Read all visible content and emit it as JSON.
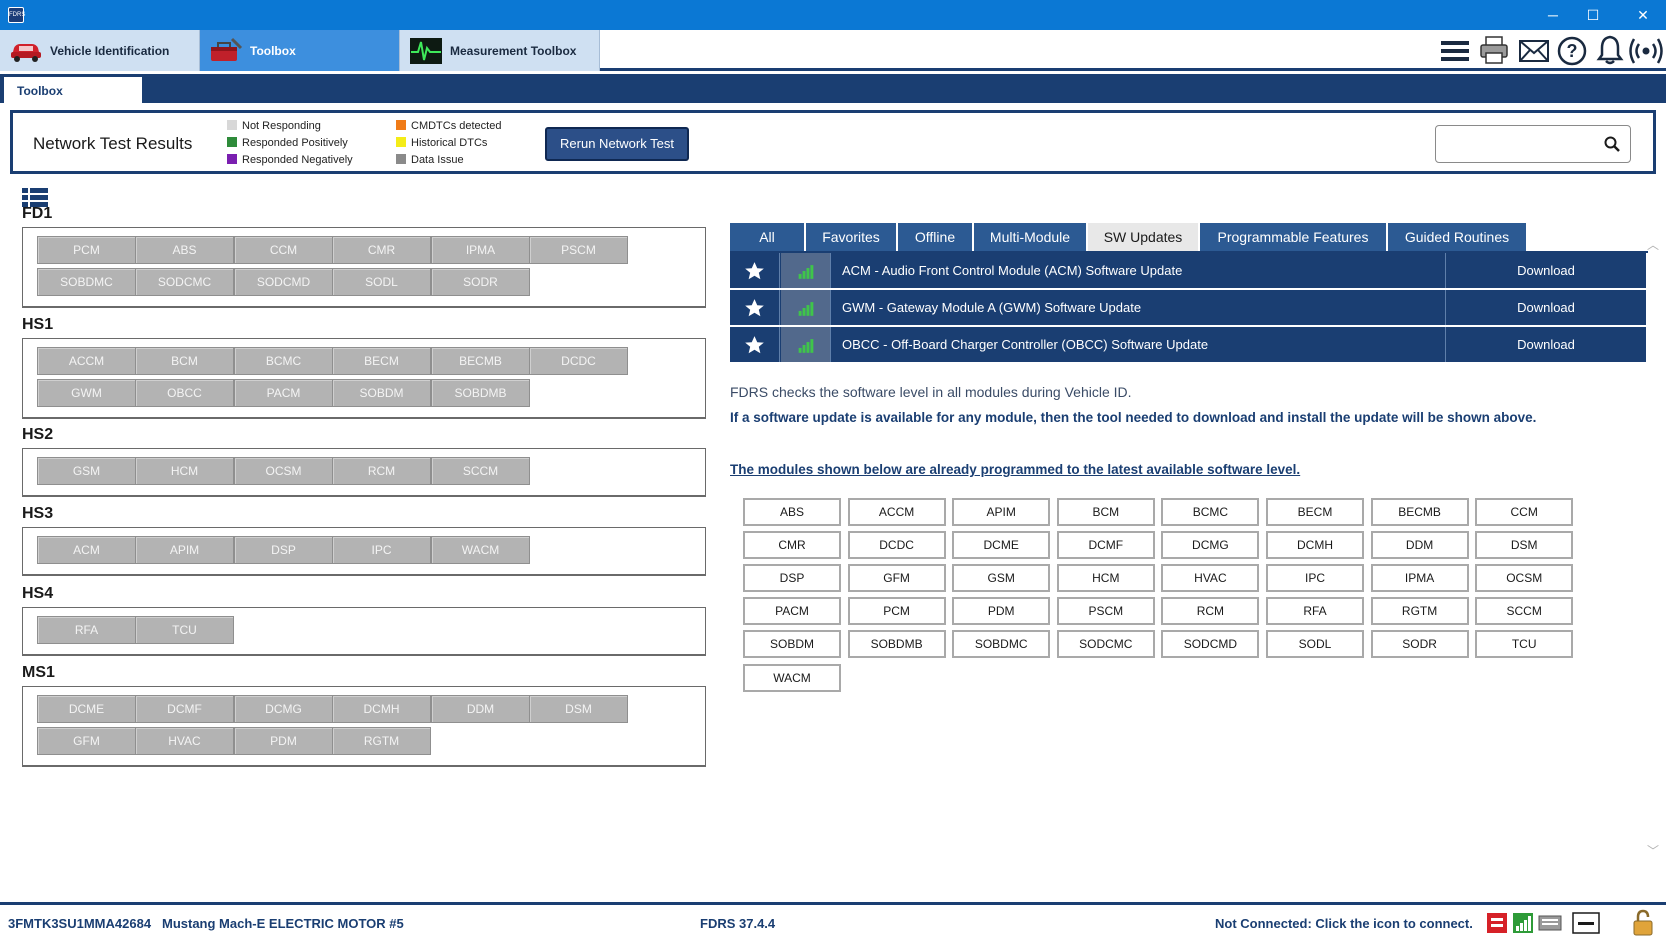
{
  "titlebar": {
    "minimize": "─",
    "maximize": "☐",
    "close": "✕"
  },
  "nav": {
    "tabs": [
      {
        "label": "Vehicle Identification",
        "icon": "car-icon"
      },
      {
        "label": "Toolbox",
        "icon": "toolbox-icon"
      },
      {
        "label": "Measurement Toolbox",
        "icon": "oscilloscope-icon"
      }
    ],
    "toolbar_icons": [
      "menu-icon",
      "printer-icon",
      "mail-icon",
      "help-icon",
      "bell-icon",
      "wireless-icon"
    ]
  },
  "subtab": {
    "label": "Toolbox"
  },
  "network": {
    "title": "Network Test Results",
    "legend": [
      {
        "label": "Not Responding",
        "color": "#d8d8d8"
      },
      {
        "label": "Responded Positively",
        "color": "#2e8b3a"
      },
      {
        "label": "Responded Negatively",
        "color": "#7a1fb0"
      },
      {
        "label": "CMDTCs detected",
        "color": "#f07b17"
      },
      {
        "label": "Historical DTCs",
        "color": "#f4ec18"
      },
      {
        "label": "Data Issue",
        "color": "#8a8a8a"
      }
    ],
    "rerun_label": "Rerun Network Test",
    "search_placeholder": ""
  },
  "groups": [
    {
      "name": "FD1",
      "modules": [
        "PCM",
        "ABS",
        "CCM",
        "CMR",
        "IPMA",
        "PSCM",
        "SOBDMC",
        "SODCMC",
        "SODCMD",
        "SODL",
        "SODR"
      ]
    },
    {
      "name": "HS1",
      "modules": [
        "ACCM",
        "BCM",
        "BCMC",
        "BECM",
        "BECMB",
        "DCDC",
        "GWM",
        "OBCC",
        "PACM",
        "SOBDM",
        "SOBDMB"
      ]
    },
    {
      "name": "HS2",
      "modules": [
        "GSM",
        "HCM",
        "OCSM",
        "RCM",
        "SCCM"
      ]
    },
    {
      "name": "HS3",
      "modules": [
        "ACM",
        "APIM",
        "DSP",
        "IPC",
        "WACM"
      ]
    },
    {
      "name": "HS4",
      "modules": [
        "RFA",
        "TCU"
      ]
    },
    {
      "name": "MS1",
      "modules": [
        "DCME",
        "DCMF",
        "DCMG",
        "DCMH",
        "DDM",
        "DSM",
        "GFM",
        "HVAC",
        "PDM",
        "RGTM"
      ]
    }
  ],
  "filter_tabs": [
    "All",
    "Favorites",
    "Offline",
    "Multi-Module",
    "SW Updates",
    "Programmable Features",
    "Guided Routines"
  ],
  "active_filter": "SW Updates",
  "updates": [
    {
      "description": "ACM - Audio Front Control Module (ACM) Software Update",
      "action": "Download"
    },
    {
      "description": "GWM - Gateway Module A (GWM) Software Update",
      "action": "Download"
    },
    {
      "description": "OBCC - Off-Board Charger Controller (OBCC) Software Update",
      "action": "Download"
    }
  ],
  "info": {
    "line1": "FDRS checks the software level in all modules during Vehicle ID.",
    "line2": "If a software update is available for any module, then the tool needed to download and install the update will be shown above.",
    "line3": "The modules shown below are already programmed to the latest available software level."
  },
  "programmed_modules": [
    "ABS",
    "ACCM",
    "APIM",
    "BCM",
    "BCMC",
    "BECM",
    "BECMB",
    "CCM",
    "CMR",
    "DCDC",
    "DCME",
    "DCMF",
    "DCMG",
    "DCMH",
    "DDM",
    "DSM",
    "DSP",
    "GFM",
    "GSM",
    "HCM",
    "HVAC",
    "IPC",
    "IPMA",
    "OCSM",
    "PACM",
    "PCM",
    "PDM",
    "PSCM",
    "RCM",
    "RFA",
    "RGTM",
    "SCCM",
    "SOBDM",
    "SOBDMB",
    "SOBDMC",
    "SODCMC",
    "SODCMD",
    "SODL",
    "SODR",
    "TCU",
    "WACM"
  ],
  "status": {
    "vin": "3FMTK3SU1MMA42684",
    "vehicle": "Mustang Mach-E ELECTRIC MOTOR #5",
    "version": "FDRS 37.4.4",
    "connection": "Not Connected: Click the icon to connect.",
    "icons": [
      "vci-red-icon",
      "signal-icon",
      "keyboard-icon",
      "dash-icon",
      "lock-icon"
    ]
  }
}
